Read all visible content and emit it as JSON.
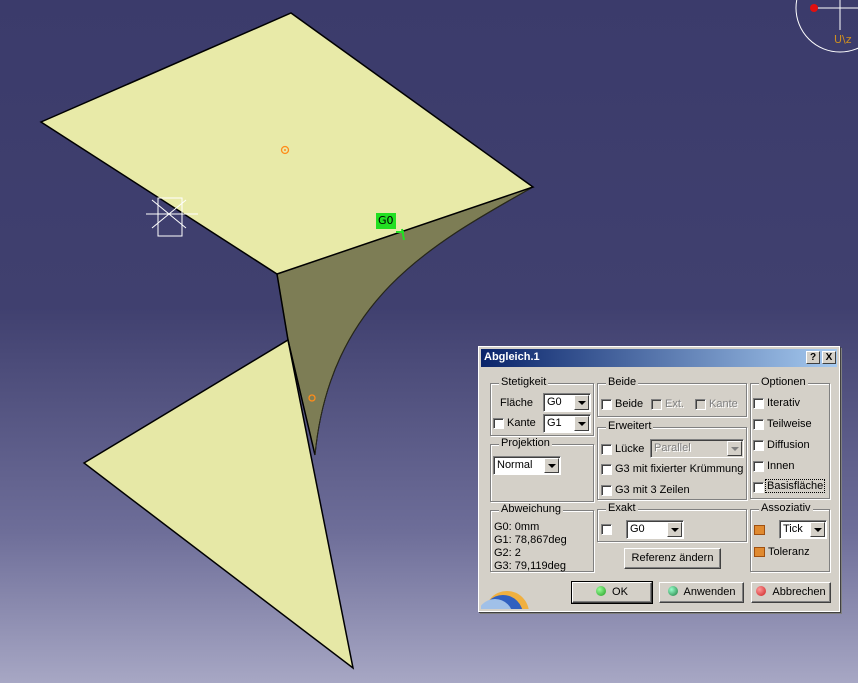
{
  "viewport": {
    "g0_tag": "G0",
    "compass_label": "U\\z"
  },
  "dialog": {
    "title": "Abgleich.1",
    "help_button": "?",
    "close_button": "X",
    "stetigkeit": {
      "title": "Stetigkeit",
      "flaeche_label": "Fläche",
      "flaeche_value": "G0",
      "kante_label": "Kante",
      "kante_value": "G1"
    },
    "beide": {
      "title": "Beide",
      "beide_label": "Beide",
      "ext_label": "Ext.",
      "kante_label": "Kante"
    },
    "optionen": {
      "title": "Optionen",
      "iterativ": "Iterativ",
      "teilweise": "Teilweise",
      "diffusion": "Diffusion",
      "innen": "Innen",
      "basisflaeche": "Basisfläche"
    },
    "erweitert": {
      "title": "Erweitert",
      "luecke_label": "Lücke",
      "luecke_value": "Parallel",
      "g3_fix": "G3 mit fixierter Krümmung",
      "g3_zeilen": "G3 mit 3 Zeilen"
    },
    "projektion": {
      "title": "Projektion",
      "value": "Normal"
    },
    "abweichung": {
      "title": "Abweichung",
      "lines": [
        "G0: 0mm",
        "G1: 78,867deg",
        "G2: 2",
        "G3: 79,119deg"
      ]
    },
    "exakt": {
      "title": "Exakt",
      "value": "G0"
    },
    "referenz_button": "Referenz ändern",
    "assoziativ": {
      "title": "Assoziativ",
      "tick_value": "Tick",
      "toleranz": "Toleranz"
    },
    "buttons": {
      "ok": "OK",
      "anwenden": "Anwenden",
      "abbrechen": "Abbrechen"
    },
    "colors": {
      "ok_ball": "#1f9a1f",
      "anwenden_ball": "#1a7a3a",
      "abbrechen_ball": "#cc2020"
    }
  },
  "colors": {
    "surface": "#e8eaa8",
    "surface_dark": "#7d7d55",
    "marker": "#ff8c1a",
    "g0_tag": "#22e022"
  }
}
